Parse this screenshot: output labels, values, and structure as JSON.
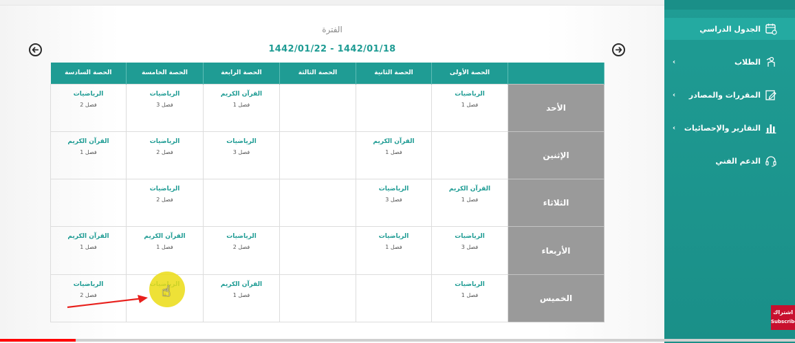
{
  "period": {
    "label": "الفترة",
    "range": "1442/01/22 - 1442/01/18"
  },
  "schedule": {
    "headers": [
      "الحصة السادسة",
      "الحصة الخامسة",
      "الحصة الرابعة",
      "الحصة الثالثة",
      "الحصة الثانية",
      "الحصة الأولى"
    ],
    "rows": [
      {
        "day": "الأحد",
        "cells": [
          {
            "subject": "الرياضيات",
            "class": "فصل 2"
          },
          {
            "subject": "الرياضيات",
            "class": "فصل 3"
          },
          {
            "subject": "القرآن الكريم",
            "class": "فصل 1"
          },
          {
            "subject": "",
            "class": ""
          },
          {
            "subject": "",
            "class": ""
          },
          {
            "subject": "الرياضيات",
            "class": "فصل 1"
          }
        ]
      },
      {
        "day": "الإثنين",
        "cells": [
          {
            "subject": "القرآن الكريم",
            "class": "فصل 1"
          },
          {
            "subject": "الرياضيات",
            "class": "فصل 2"
          },
          {
            "subject": "الرياضيات",
            "class": "فصل 3"
          },
          {
            "subject": "",
            "class": ""
          },
          {
            "subject": "القرآن الكريم",
            "class": "فصل 1"
          },
          {
            "subject": "",
            "class": ""
          }
        ]
      },
      {
        "day": "الثلاثاء",
        "cells": [
          {
            "subject": "",
            "class": ""
          },
          {
            "subject": "الرياضيات",
            "class": "فصل 2"
          },
          {
            "subject": "",
            "class": ""
          },
          {
            "subject": "",
            "class": ""
          },
          {
            "subject": "الرياضيات",
            "class": "فصل 3"
          },
          {
            "subject": "القرآن الكريم",
            "class": "فصل 1"
          }
        ]
      },
      {
        "day": "الأربعاء",
        "cells": [
          {
            "subject": "القرآن الكريم",
            "class": "فصل 1"
          },
          {
            "subject": "القرآن الكريم",
            "class": "فصل 1"
          },
          {
            "subject": "الرياضيات",
            "class": "فصل 2"
          },
          {
            "subject": "",
            "class": ""
          },
          {
            "subject": "الرياضيات",
            "class": "فصل 1"
          },
          {
            "subject": "الرياضيات",
            "class": "فصل 3"
          }
        ]
      },
      {
        "day": "الخميس",
        "cells": [
          {
            "subject": "الرياضيات",
            "class": "فصل 2"
          },
          {
            "subject": "الرياضيات",
            "class": "3"
          },
          {
            "subject": "القرآن الكريم",
            "class": "فصل 1"
          },
          {
            "subject": "",
            "class": ""
          },
          {
            "subject": "",
            "class": ""
          },
          {
            "subject": "الرياضيات",
            "class": "فصل 1"
          }
        ]
      }
    ]
  },
  "sidebar": {
    "items": [
      {
        "label": "الجدول الدراسي",
        "icon": "calendar-icon",
        "active": true,
        "chevron": false
      },
      {
        "label": "الطلاب",
        "icon": "student-icon",
        "active": false,
        "chevron": true
      },
      {
        "label": "المقررات والمصادر",
        "icon": "edit-icon",
        "active": false,
        "chevron": true
      },
      {
        "label": "التقارير والإحصائيات",
        "icon": "bar-chart-icon",
        "active": false,
        "chevron": true
      },
      {
        "label": "الدعم الفني",
        "icon": "headset-icon",
        "active": false,
        "chevron": false
      }
    ]
  },
  "subscribe": {
    "label_ar": "اشتراك",
    "label_en": "Subscribe"
  },
  "video": {
    "progress_fraction": 0.095
  },
  "colors": {
    "accent": "#1f9c94",
    "day_cell": "#9a9a9a",
    "subscribe": "#c8102e",
    "progress": "#ff0000"
  }
}
